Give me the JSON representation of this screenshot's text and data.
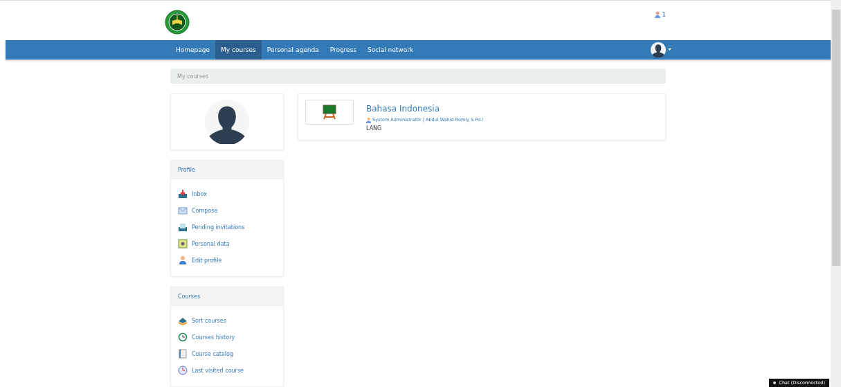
{
  "header": {
    "notifications": {
      "count": "1"
    }
  },
  "navbar": {
    "items": [
      {
        "label": "Homepage",
        "selected": false
      },
      {
        "label": "My courses",
        "selected": true
      },
      {
        "label": "Personal agenda",
        "selected": false
      },
      {
        "label": "Progress",
        "selected": false
      },
      {
        "label": "Social network",
        "selected": false
      }
    ]
  },
  "breadcrumb": "My courses",
  "sidebar": {
    "panels": [
      {
        "title": "Profile",
        "items": [
          {
            "label": "Inbox",
            "kind": "inbox"
          },
          {
            "label": "Compose",
            "kind": "compose"
          },
          {
            "label": "Pending invitations",
            "kind": "invitations"
          },
          {
            "label": "Personal data",
            "kind": "data"
          },
          {
            "label": "Edit profile",
            "kind": "profile"
          }
        ]
      },
      {
        "title": "Courses",
        "items": [
          {
            "label": "Sort courses",
            "kind": "sort"
          },
          {
            "label": "Courses history",
            "kind": "history"
          },
          {
            "label": "Course catalog",
            "kind": "catalog"
          },
          {
            "label": "Last visited course",
            "kind": "last"
          }
        ]
      }
    ]
  },
  "courses": [
    {
      "title": "Bahasa Indonesia",
      "teachers": "System Administrator | Abdul Wahid Romly S.Pd.I",
      "code": "LANG"
    }
  ],
  "chat": {
    "label": "Chat (Disconnected)"
  }
}
